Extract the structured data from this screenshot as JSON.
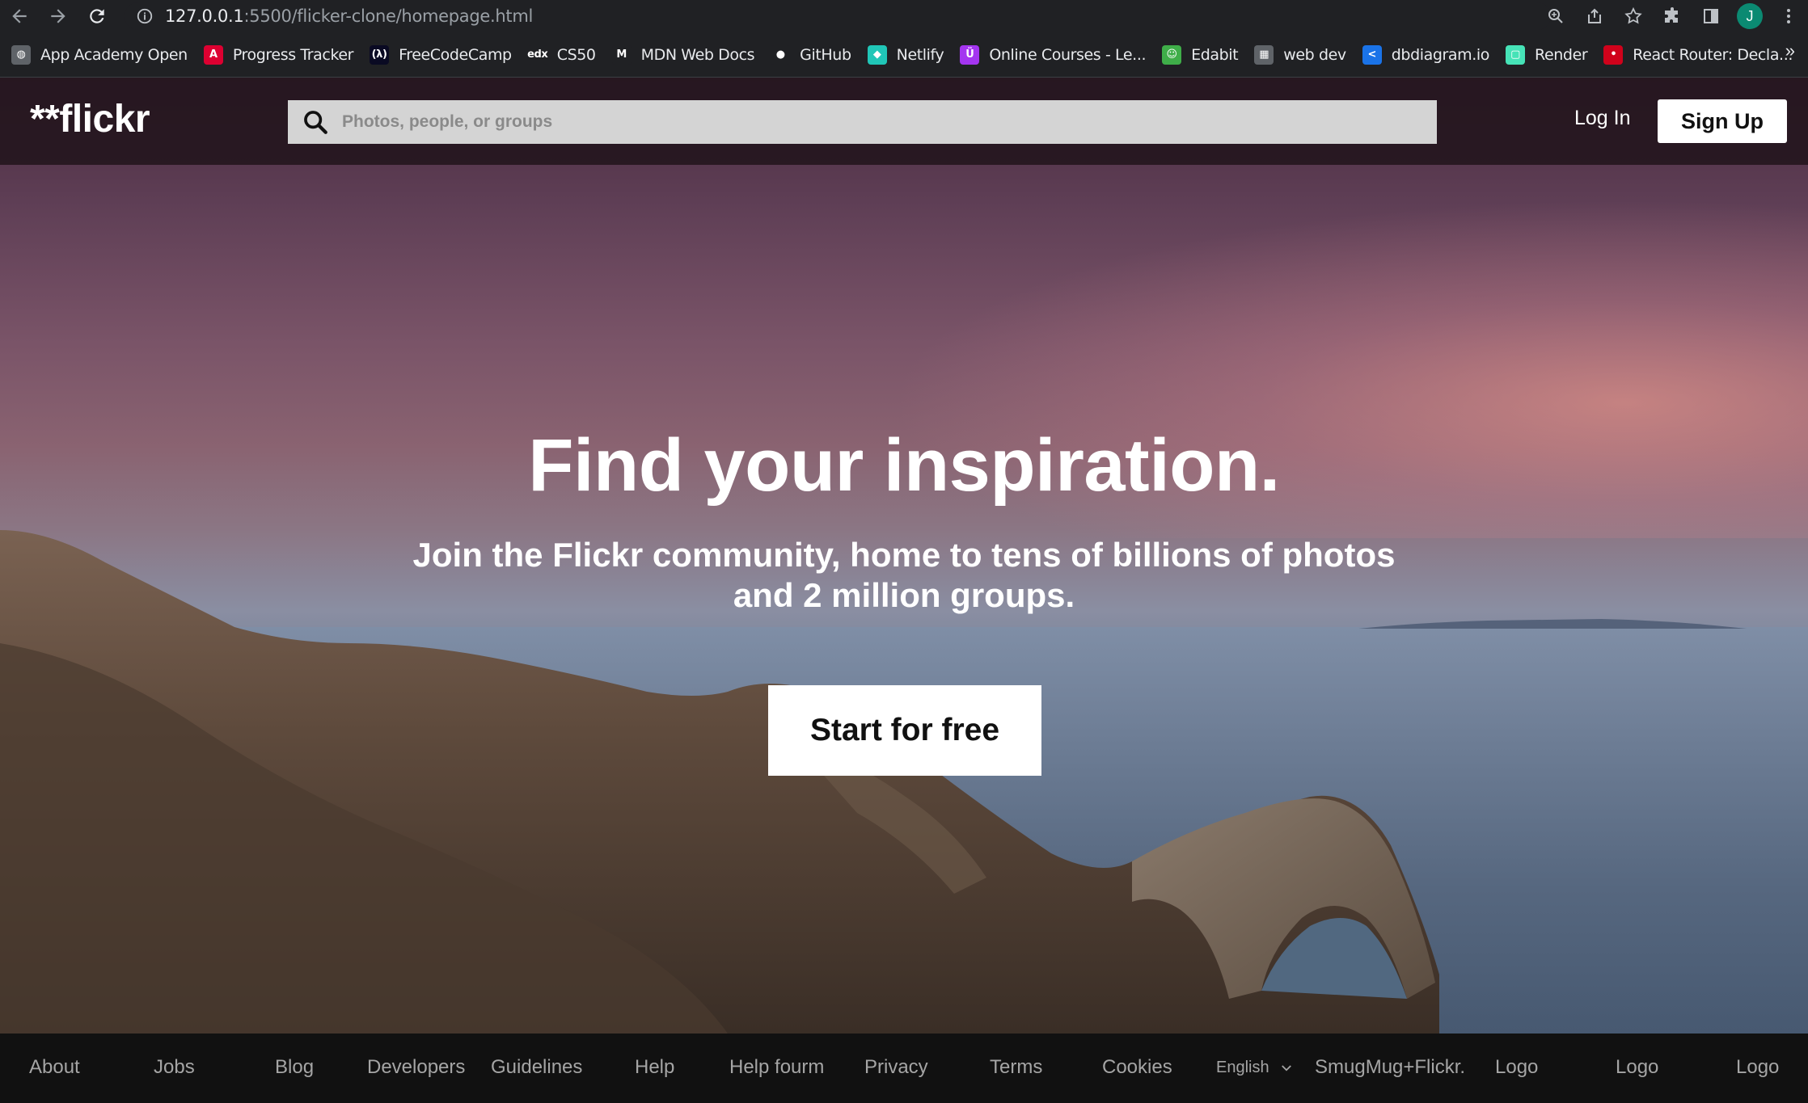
{
  "browser": {
    "url_host": "127.0.0.1",
    "url_path": ":5500/flicker-clone/homepage.html",
    "avatar_letter": "J",
    "bookmarks": [
      {
        "label": "App Academy Open",
        "icon": "globe-icon",
        "color": "#5f6368"
      },
      {
        "label": "Progress Tracker",
        "icon": "angular-icon",
        "color": "#dd0031"
      },
      {
        "label": "FreeCodeCamp",
        "icon": "freecodecamp-icon",
        "color": "#0a0a23"
      },
      {
        "label": "CS50",
        "icon": "edx-icon",
        "color": "#202124"
      },
      {
        "label": "MDN Web Docs",
        "icon": "mdn-icon",
        "color": "#202124"
      },
      {
        "label": "GitHub",
        "icon": "github-icon",
        "color": "#202124"
      },
      {
        "label": "Netlify",
        "icon": "netlify-icon",
        "color": "#20c6b7"
      },
      {
        "label": "Online Courses - Le...",
        "icon": "udemy-icon",
        "color": "#a435f0"
      },
      {
        "label": "Edabit",
        "icon": "edabit-icon",
        "color": "#3fae49"
      },
      {
        "label": "web dev",
        "icon": "folder-icon",
        "color": "#5f6368"
      },
      {
        "label": "dbdiagram.io",
        "icon": "dbdiagram-icon",
        "color": "#1a73e8"
      },
      {
        "label": "Render",
        "icon": "render-icon",
        "color": "#46e3b7"
      },
      {
        "label": "React Router: Decla...",
        "icon": "react-router-icon",
        "color": "#d0021b"
      }
    ],
    "more_label": "»"
  },
  "header": {
    "logo": "**flickr",
    "search_placeholder": "Photos, people, or groups",
    "login_label": "Log In",
    "signup_label": "Sign Up"
  },
  "hero": {
    "headline": "Find your inspiration.",
    "subline": "Join the Flickr community, home to tens of billions of photos and 2 million groups.",
    "cta_label": "Start for free"
  },
  "footer": {
    "links": [
      "About",
      "Jobs",
      "Blog",
      "Developers",
      "Guidelines",
      "Help",
      "Help fourm",
      "Privacy",
      "Terms",
      "Cookies"
    ],
    "language": "English",
    "brand": "SmugMug+Flickr.",
    "logos": [
      "Logo",
      "Logo",
      "Logo"
    ]
  }
}
